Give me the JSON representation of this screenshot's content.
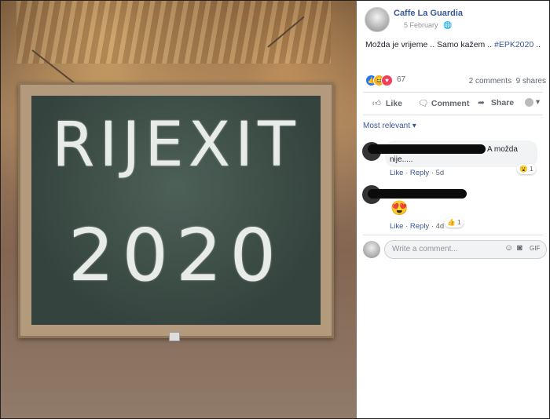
{
  "photo": {
    "chalkboard_line1": "RIJEXIT",
    "chalkboard_line2": "2020"
  },
  "post": {
    "page_name": "Caffe La Guardia",
    "date": "5 February",
    "text": "Možda je vrijeme .. Samo kažem .. ",
    "hashtag": "#EPK2020",
    "text_tail": " ..",
    "reaction_count": "67",
    "comments_count": "2 comments",
    "shares_count": "9 shares"
  },
  "actions": {
    "like": "Like",
    "comment": "Comment",
    "share": "Share"
  },
  "comments_filter": "Most relevant ▾",
  "comments": [
    {
      "text_line1": "A možda",
      "text_line2": "nije.....",
      "like": "Like",
      "reply": "Reply",
      "age": "5d",
      "reaction_count": "1"
    },
    {
      "emoji": "😍",
      "like": "Like",
      "reply": "Reply",
      "age": "4d",
      "reaction_count": "1"
    }
  ],
  "composer": {
    "placeholder": "Write a comment..."
  },
  "colors": {
    "link": "#385898",
    "muted": "#606770",
    "like_blue": "#2078f4"
  }
}
